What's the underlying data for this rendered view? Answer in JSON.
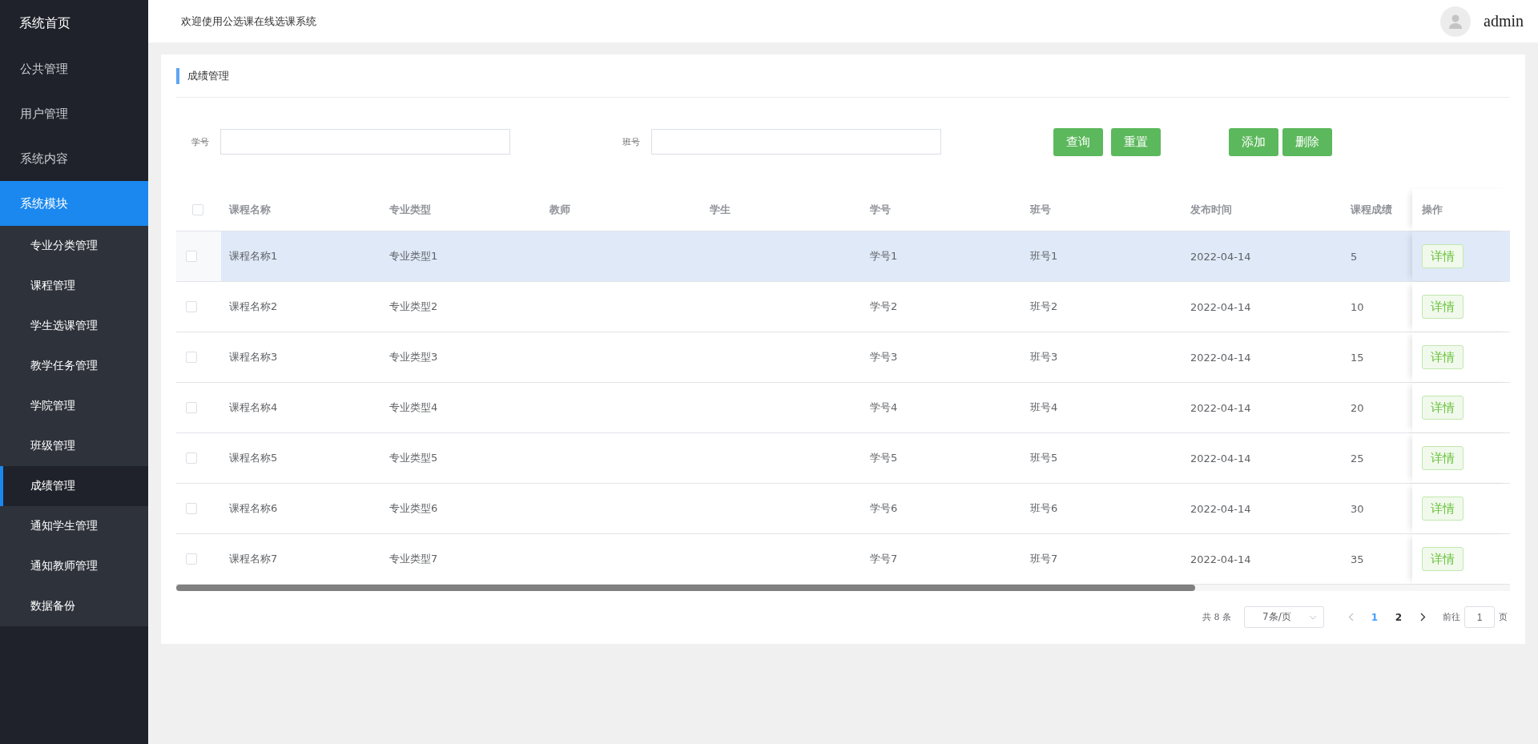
{
  "sidebar": {
    "title": "系统首页",
    "items": [
      {
        "label": "公共管理",
        "selected": false
      },
      {
        "label": "用户管理",
        "selected": false
      },
      {
        "label": "系统内容",
        "selected": false
      },
      {
        "label": "系统模块",
        "selected": true,
        "children": [
          {
            "label": "专业分类管理",
            "selected": false
          },
          {
            "label": "课程管理",
            "selected": false
          },
          {
            "label": "学生选课管理",
            "selected": false
          },
          {
            "label": "教学任务管理",
            "selected": false
          },
          {
            "label": "学院管理",
            "selected": false
          },
          {
            "label": "班级管理",
            "selected": false
          },
          {
            "label": "成绩管理",
            "selected": true
          },
          {
            "label": "通知学生管理",
            "selected": false
          },
          {
            "label": "通知教师管理",
            "selected": false
          },
          {
            "label": "数据备份",
            "selected": false
          }
        ]
      }
    ]
  },
  "header": {
    "welcome": "欢迎使用公选课在线选课系统",
    "user": "admin"
  },
  "panel": {
    "title": "成绩管理",
    "search_fields": [
      {
        "label": "学号"
      },
      {
        "label": "班号"
      }
    ],
    "search_buttons": [
      "查询",
      "重置"
    ],
    "action_buttons": [
      "添加",
      "删除"
    ],
    "table": {
      "columns": [
        "课程名称",
        "专业类型",
        "教师",
        "学生",
        "学号",
        "班号",
        "发布时间",
        "课程成绩",
        "操作"
      ],
      "all_checked": false,
      "rows": [
        {
          "course_name": "课程名称1",
          "major_type": "专业类型1",
          "student_no": "学号1",
          "class_no": "班号1",
          "published": "2022-04-14",
          "score": "5",
          "action": "详情",
          "checked": false,
          "hovered": true
        },
        {
          "course_name": "课程名称2",
          "major_type": "专业类型2",
          "student_no": "学号2",
          "class_no": "班号2",
          "published": "2022-04-14",
          "score": "10",
          "action": "详情",
          "checked": false,
          "hovered": false
        },
        {
          "course_name": "课程名称3",
          "major_type": "专业类型3",
          "student_no": "学号3",
          "class_no": "班号3",
          "published": "2022-04-14",
          "score": "15",
          "action": "详情",
          "checked": false,
          "hovered": false
        },
        {
          "course_name": "课程名称4",
          "major_type": "专业类型4",
          "student_no": "学号4",
          "class_no": "班号4",
          "published": "2022-04-14",
          "score": "20",
          "action": "详情",
          "checked": false,
          "hovered": false
        },
        {
          "course_name": "课程名称5",
          "major_type": "专业类型5",
          "student_no": "学号5",
          "class_no": "班号5",
          "published": "2022-04-14",
          "score": "25",
          "action": "详情",
          "checked": false,
          "hovered": false
        },
        {
          "course_name": "课程名称6",
          "major_type": "专业类型6",
          "student_no": "学号6",
          "class_no": "班号6",
          "published": "2022-04-14",
          "score": "30",
          "action": "详情",
          "checked": false,
          "hovered": false
        },
        {
          "course_name": "课程名称7",
          "major_type": "专业类型7",
          "student_no": "学号7",
          "class_no": "班号7",
          "published": "2022-04-14",
          "score": "35",
          "action": "详情",
          "checked": false,
          "hovered": false
        }
      ]
    },
    "pagination": {
      "total": "共 8 条",
      "page_size": "7条/页",
      "prev_disabled": true,
      "pages": [
        {
          "label": "1",
          "selected": true
        },
        {
          "label": "2",
          "selected": false
        }
      ],
      "goto_label": "前往",
      "goto_value": "1",
      "goto_suffix": "页"
    }
  }
}
